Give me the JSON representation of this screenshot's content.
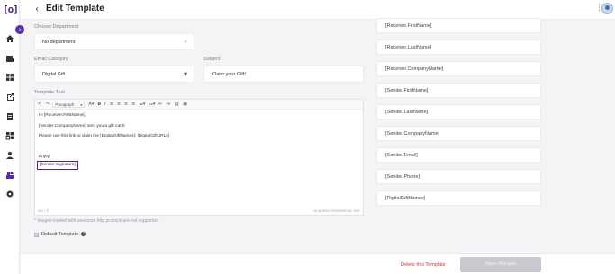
{
  "app": {
    "logo_text": "[o]",
    "page_title": "Edit Template"
  },
  "form": {
    "department_label": "Choose Department",
    "department_value": "No department",
    "email_category_label": "Email Category",
    "email_category_value": "Digital Gift",
    "subject_label": "Subject",
    "subject_value": "Claim your Gift!",
    "template_text_label": "Template Text"
  },
  "editor": {
    "toolbar": {
      "undo_icon": "undo-icon",
      "redo_icon": "redo-icon",
      "paragraph_select": "Paragraph",
      "text_color_icon": "text-color-icon",
      "bold": "B",
      "italic": "I"
    },
    "lines": [
      "Hi [Receiver.FirstName],",
      "[Sender.CompanyName] sent you a gift card!",
      "Please use this link to claim the [DigitalGiftNames]: [DigitalGiftURLs]",
      "",
      "Enjoy,",
      "[Sender.Signature]"
    ],
    "footer_left": "DIV > P",
    "footer_right": "16 WORDS  POWERED BY TINY"
  },
  "note": "* Images loaded with unsecure http protocol are not supported.",
  "default_template_label": "Default Template",
  "placeholders": [
    "[Receiver.FirstName]",
    "[Receiver.LastName]",
    "[Receiver.CompanyName]",
    "[Sender.FirstName]",
    "[Sender.LastName]",
    "[Sender.CompanyName]",
    "[Sender.Email]",
    "[Sender.Phone]",
    "[DigitalGiftNames]"
  ],
  "actions": {
    "delete_label": "Delete this Template",
    "save_label": "Save changes"
  },
  "colors": {
    "accent": "#5b2da3",
    "danger": "#d9363e",
    "disabled_button": "#c9c9cf"
  }
}
